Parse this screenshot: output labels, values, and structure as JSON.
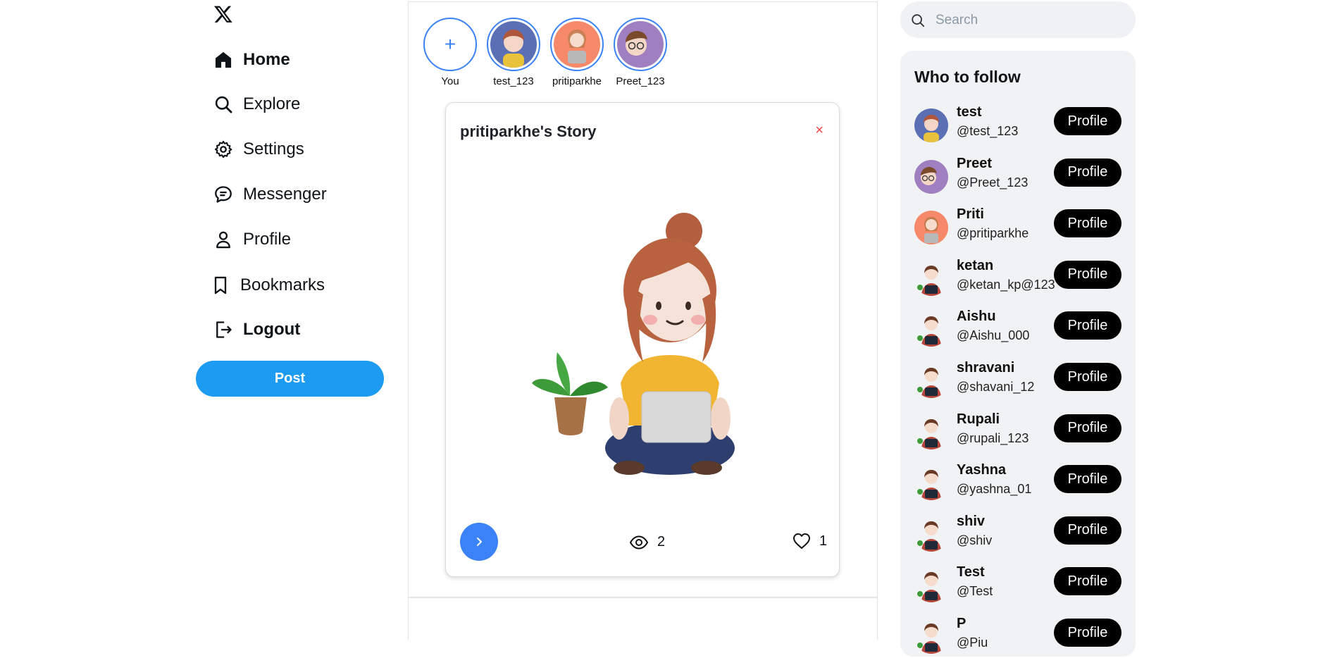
{
  "nav": {
    "items": [
      {
        "label": "Home",
        "icon": "home-icon",
        "bold": true
      },
      {
        "label": "Explore",
        "icon": "search-icon",
        "bold": false
      },
      {
        "label": "Settings",
        "icon": "gear-icon",
        "bold": false
      },
      {
        "label": "Messenger",
        "icon": "chat-icon",
        "bold": false
      },
      {
        "label": "Profile",
        "icon": "user-icon",
        "bold": false
      },
      {
        "label": "Bookmarks",
        "icon": "bookmark-icon",
        "bold": false
      },
      {
        "label": "Logout",
        "icon": "logout-icon",
        "bold": true
      }
    ],
    "post_label": "Post"
  },
  "stories": {
    "add_symbol": "+",
    "items": [
      {
        "name": "You"
      },
      {
        "name": "test_123"
      },
      {
        "name": "pritiparkhe"
      },
      {
        "name": "Preet_123"
      }
    ]
  },
  "story_viewer": {
    "title": "pritiparkhe's Story",
    "close_symbol": "×",
    "views": "2",
    "likes": "1"
  },
  "search": {
    "placeholder": "Search"
  },
  "who_to_follow": {
    "title": "Who to follow",
    "button_label": "Profile",
    "users": [
      {
        "name": "test",
        "handle": "@test_123"
      },
      {
        "name": "Preet",
        "handle": "@Preet_123"
      },
      {
        "name": "Priti",
        "handle": "@pritiparkhe"
      },
      {
        "name": "ketan",
        "handle": "@ketan_kp@123"
      },
      {
        "name": "Aishu",
        "handle": "@Aishu_000"
      },
      {
        "name": "shravani",
        "handle": "@shavani_12"
      },
      {
        "name": "Rupali",
        "handle": "@rupali_123"
      },
      {
        "name": "Yashna",
        "handle": "@yashna_01"
      },
      {
        "name": "shiv",
        "handle": "@shiv"
      },
      {
        "name": "Test",
        "handle": "@Test"
      },
      {
        "name": "P",
        "handle": "@Piu"
      }
    ]
  },
  "colors": {
    "accent": "#1d9bf0",
    "story_ring": "#3b82f6",
    "close": "#ef4444"
  }
}
